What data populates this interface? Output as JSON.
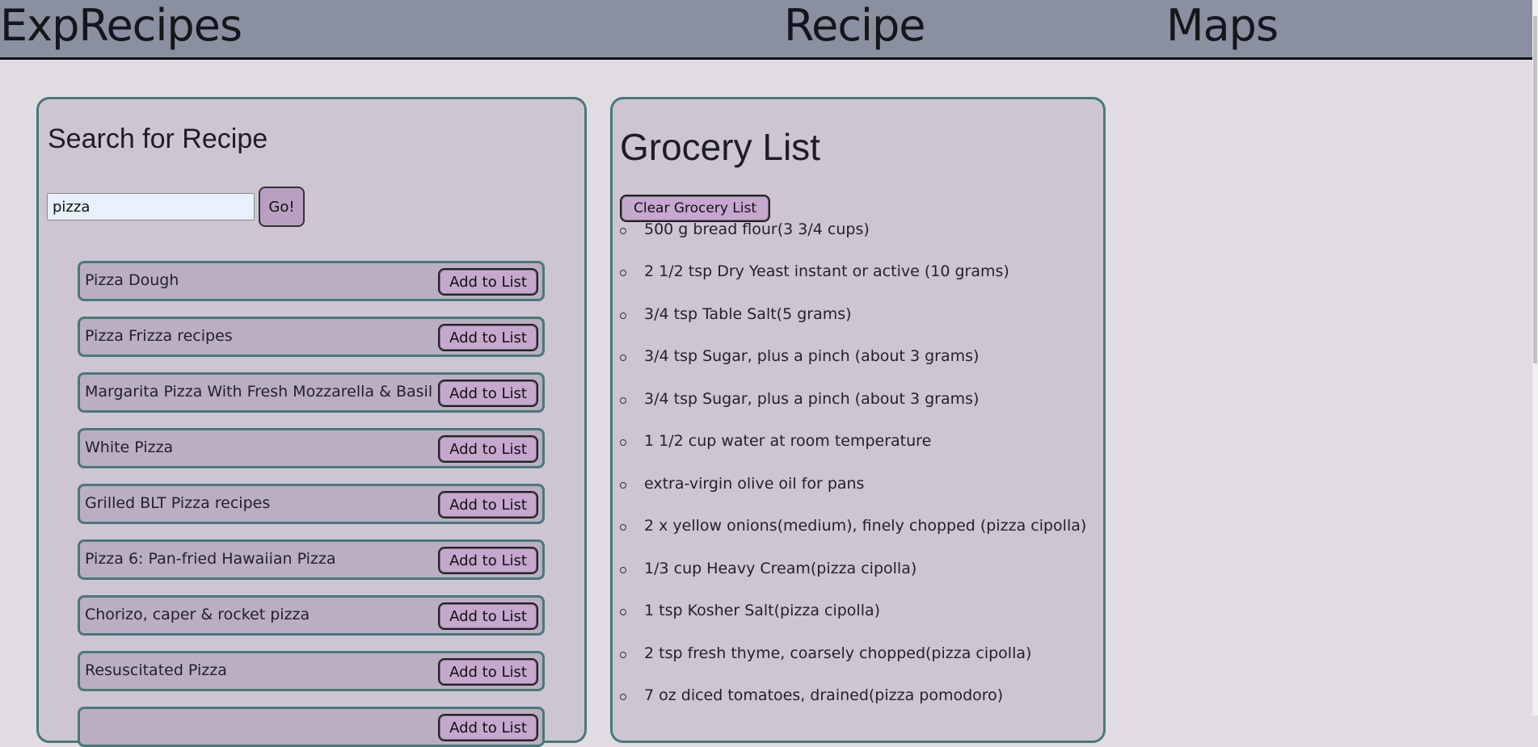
{
  "header": {
    "brand": "ExpRecipes",
    "nav": [
      "Recipe",
      "Maps"
    ]
  },
  "search": {
    "title": "Search for Recipe",
    "query": "pizza",
    "go_label": "Go!",
    "add_label": "Add to List",
    "results": [
      "Pizza Dough",
      "Pizza Frizza recipes",
      "Margarita Pizza With Fresh Mozzarella & Basil",
      "White Pizza",
      "Grilled BLT Pizza recipes",
      "Pizza 6: Pan-fried Hawaiian Pizza",
      "Chorizo, caper & rocket pizza",
      "Resuscitated Pizza",
      ""
    ]
  },
  "grocery": {
    "title": "Grocery List",
    "clear_label": "Clear Grocery List",
    "items": [
      "500 g bread flour(3 3/4 cups)",
      "2 1/2 tsp Dry Yeast instant or active (10 grams)",
      "3/4 tsp Table Salt(5 grams)",
      "3/4 tsp Sugar, plus a pinch (about 3 grams)",
      "3/4 tsp Sugar, plus a pinch (about 3 grams)",
      "1 1/2 cup water at room temperature",
      "extra-virgin olive oil for pans",
      "2 x yellow onions(medium), finely chopped (pizza cipolla)",
      "1/3 cup Heavy Cream(pizza cipolla)",
      "1 tsp Kosher Salt(pizza cipolla)",
      "2 tsp fresh thyme, coarsely chopped(pizza cipolla)",
      "7 oz diced tomatoes, drained(pizza pomodoro)"
    ]
  },
  "colors": {
    "header_bg": "#8a909f",
    "page_bg": "#e1dce2",
    "panel_bg": "#cec5d3",
    "panel_border": "#477a78",
    "row_bg": "#bbaec2",
    "button_bg": "#c6a8cf"
  }
}
